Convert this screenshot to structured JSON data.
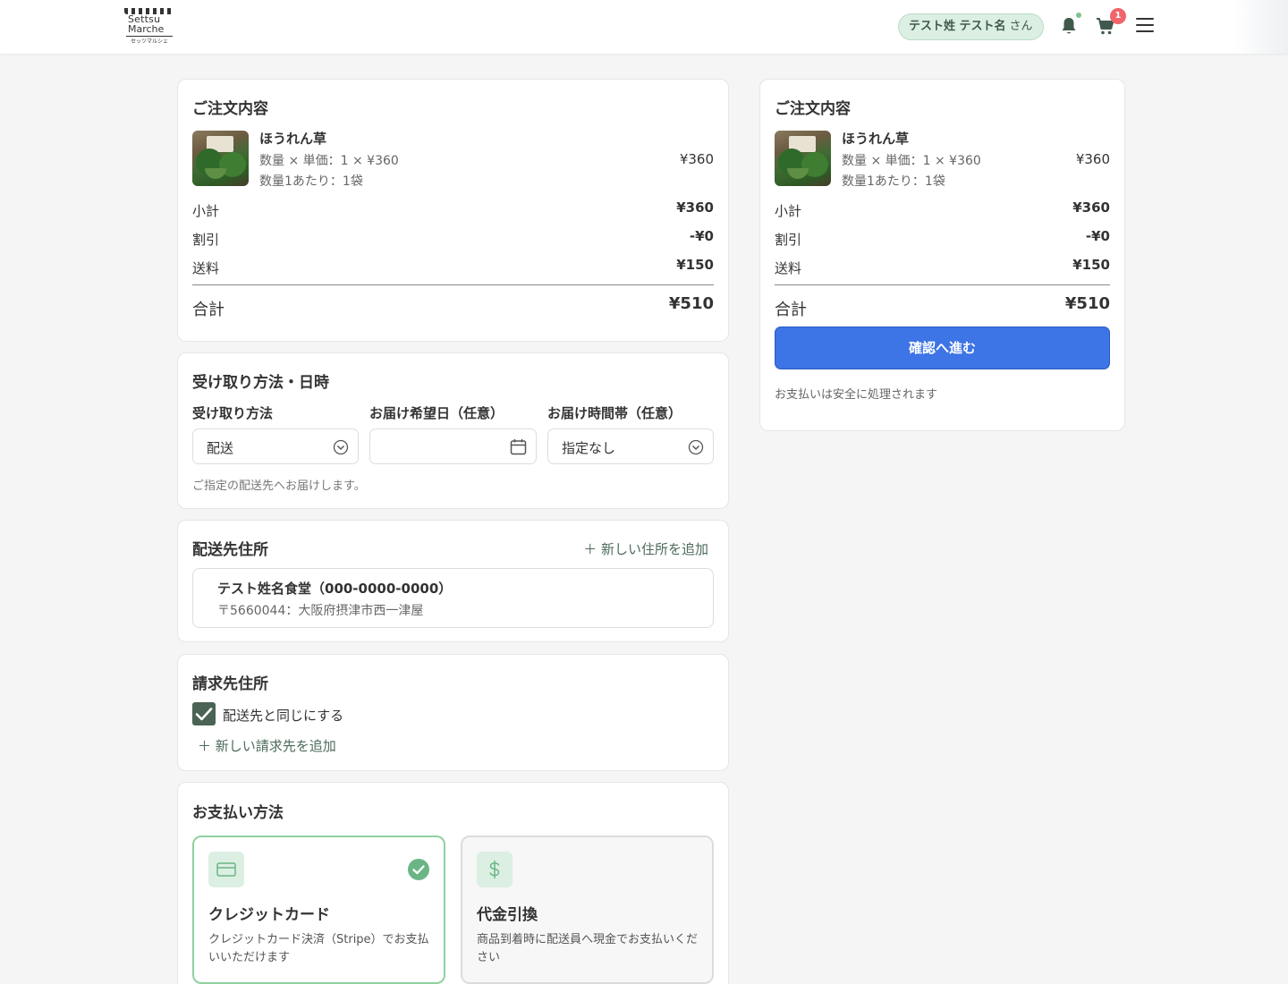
{
  "header": {
    "logo": {
      "line1": "Settsu",
      "line2": "Marche",
      "sub": "セッツマルシェ"
    },
    "user": {
      "name": "テスト姓 テスト名",
      "suffix": "さん"
    },
    "cart_count": "1"
  },
  "order_summary": {
    "title": "ご注文内容",
    "item": {
      "name": "ほうれん草",
      "qty_line": "数量 × 単価：1 × ¥360",
      "unit_line": "数量1あたり：1袋",
      "price": "¥360"
    },
    "subtotal_label": "小計",
    "subtotal": "¥360",
    "discount_label": "割引",
    "discount": "-¥0",
    "shipping_label": "送料",
    "shipping": "¥150",
    "total_label": "合計",
    "total": "¥510"
  },
  "pickup": {
    "title": "受け取り方法・日時",
    "method_label": "受け取り方法",
    "method_value": "配送",
    "date_label": "お届け希望日（任意）",
    "date_value": "",
    "time_label": "お届け時間帯（任意）",
    "time_value": "指定なし",
    "hint": "ご指定の配送先へお届けします。"
  },
  "shipping_address": {
    "title": "配送先住所",
    "add_label": "＋ 新しい住所を追加",
    "name": "テスト姓名食堂（000-0000-0000）",
    "address": "〒5660044：大阪府摂津市西一津屋"
  },
  "billing": {
    "title": "請求先住所",
    "same_label": "配送先と同じにする",
    "same_checked": true,
    "add_label": "＋ 新しい請求先を追加"
  },
  "payment": {
    "title": "お支払い方法",
    "options": [
      {
        "title": "クレジットカード",
        "desc": "クレジットカード決済（Stripe）でお支払いいただけます",
        "selected": true,
        "icon": "credit-card-icon"
      },
      {
        "title": "代金引換",
        "desc": "商品到着時に配送員へ現金でお支払いください",
        "selected": false,
        "icon": "dollar-icon"
      }
    ]
  },
  "sidebar": {
    "cta_label": "確認へ進む",
    "secure_note": "お支払いは安全に処理されます"
  },
  "colors": {
    "primary": "#3d74e6",
    "accent_green": "#4a6355",
    "chip_bg": "#dcefe3",
    "badge_red": "#f0646a"
  }
}
